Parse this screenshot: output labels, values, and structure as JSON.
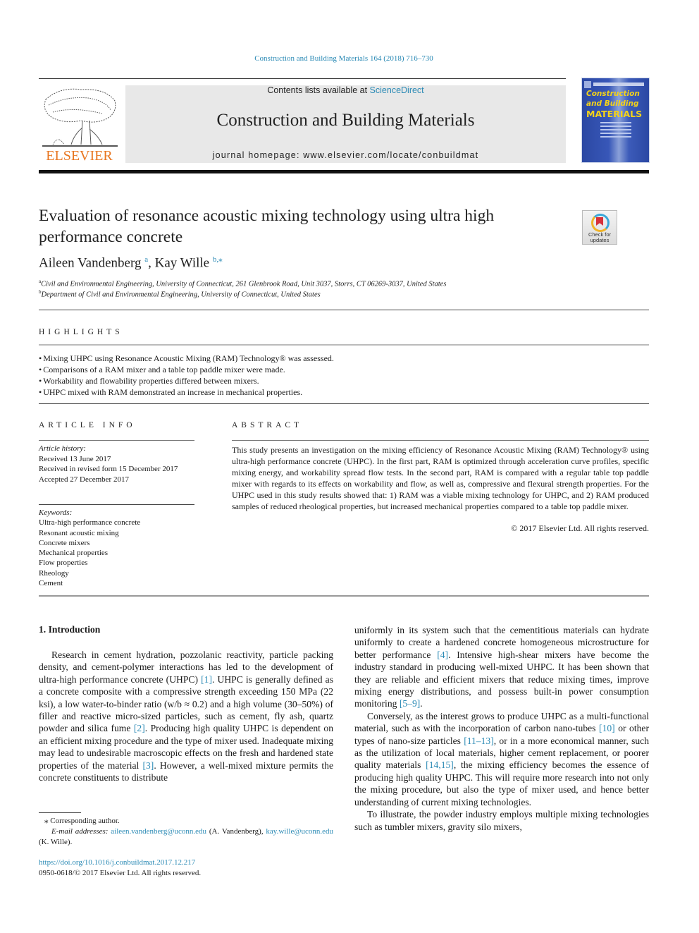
{
  "header": {
    "citation": "Construction and Building Materials 164 (2018) 716–730",
    "publisher_logo_text": "ELSEVIER",
    "contents_prefix": "Contents lists available at ",
    "contents_link": "ScienceDirect",
    "journal_title": "Construction and Building Materials",
    "homepage": "journal homepage: www.elsevier.com/locate/conbuildmat",
    "cover": {
      "line1": "Construction",
      "line2": "and Building",
      "line3": "MATERIALS",
      "bg_color": "#2b48a3",
      "title_color": "#f3d21a"
    },
    "crossmark_label": "Check for updates"
  },
  "article": {
    "title": "Evaluation of resonance acoustic mixing technology using ultra high performance concrete",
    "authors": [
      {
        "name": "Aileen Vandenberg",
        "mark": "a"
      },
      {
        "name": "Kay Wille",
        "mark": "b,⁎"
      }
    ],
    "affiliations": [
      {
        "mark": "a",
        "text": "Civil and Environmental Engineering, University of Connecticut, 261 Glenbrook Road, Unit 3037, Storrs, CT 06269-3037, United States"
      },
      {
        "mark": "b",
        "text": "Department of Civil and Environmental Engineering, University of Connecticut, United States"
      }
    ]
  },
  "highlights": {
    "heading": "HIGHLIGHTS",
    "items": [
      "Mixing UHPC using Resonance Acoustic Mixing (RAM) Technology® was assessed.",
      "Comparisons of a RAM mixer and a table top paddle mixer were made.",
      "Workability and flowability properties differed between mixers.",
      "UHPC mixed with RAM demonstrated an increase in mechanical properties."
    ]
  },
  "article_info": {
    "heading": "ARTICLE INFO",
    "history_label": "Article history:",
    "history": [
      "Received 13 June 2017",
      "Received in revised form 15 December 2017",
      "Accepted 27 December 2017"
    ],
    "keywords_label": "Keywords:",
    "keywords": [
      "Ultra-high performance concrete",
      "Resonant acoustic mixing",
      "Concrete mixers",
      "Mechanical properties",
      "Flow properties",
      "Rheology",
      "Cement"
    ]
  },
  "abstract": {
    "heading": "ABSTRACT",
    "text": "This study presents an investigation on the mixing efficiency of Resonance Acoustic Mixing (RAM) Technology® using ultra-high performance concrete (UHPC). In the first part, RAM is optimized through acceleration curve profiles, specific mixing energy, and workability spread flow tests. In the second part, RAM is compared with a regular table top paddle mixer with regards to its effects on workability and flow, as well as, compressive and flexural strength properties. For the UHPC used in this study results showed that: 1) RAM was a viable mixing technology for UHPC, and 2) RAM produced samples of reduced rheological properties, but increased mechanical properties compared to a table top paddle mixer.",
    "copyright": "© 2017 Elsevier Ltd. All rights reserved."
  },
  "introduction": {
    "heading": "1. Introduction",
    "col1": {
      "p1_a": "Research in cement hydration, pozzolanic reactivity, particle packing density, and cement-polymer interactions has led to the development of ultra-high performance concrete (UHPC) ",
      "ref1": "[1]",
      "p1_b": ". UHPC is generally defined as a concrete composite with a compressive strength exceeding 150 MPa (22 ksi), a low water-to-binder ratio (w/b ≈ 0.2) and a high volume (30–50%) of filler and reactive micro-sized particles, such as cement, fly ash, quartz powder and silica fume ",
      "ref2": "[2]",
      "p1_c": ". Producing high quality UHPC is dependent on an efficient mixing procedure and the type of mixer used. Inadequate mixing may lead to undesirable macroscopic effects on the fresh and hardened state properties of the material ",
      "ref3": "[3]",
      "p1_d": ". However, a well-mixed mixture permits the concrete constituents to distribute"
    },
    "col2": {
      "p0_a": "uniformly in its system such that the cementitious materials can hydrate uniformly to create a hardened concrete homogeneous microstructure for better performance ",
      "ref4": "[4]",
      "p0_b": ". Intensive high-shear mixers have become the industry standard in producing well-mixed UHPC. It has been shown that they are reliable and efficient mixers that reduce mixing times, improve mixing energy distributions, and possess built-in power consumption monitoring ",
      "ref5": "[5–9]",
      "p0_c": ".",
      "p1_a": "Conversely, as the interest grows to produce UHPC as a multi-functional material, such as with the incorporation of carbon nano-tubes ",
      "ref10": "[10]",
      "p1_b": " or other types of nano-size particles ",
      "ref11": "[11–13]",
      "p1_c": ", or in a more economical manner, such as the utilization of local materials, higher cement replacement, or poorer quality materials ",
      "ref14": "[14,15]",
      "p1_d": ", the mixing efficiency becomes the essence of producing high quality UHPC. This will require more research into not only the mixing procedure, but also the type of mixer used, and hence better understanding of current mixing technologies.",
      "p2": "To illustrate, the powder industry employs multiple mixing technologies such as tumbler mixers, gravity silo mixers,"
    }
  },
  "footnotes": {
    "corresponding": "⁎ Corresponding author.",
    "email_label": "E-mail addresses: ",
    "email1": "aileen.vandenberg@uconn.edu",
    "email1_owner": " (A. Vandenberg), ",
    "email2": "kay.wille@uconn.edu",
    "email2_owner": " (K. Wille).",
    "doi": "https://doi.org/10.1016/j.conbuildmat.2017.12.217",
    "issn": "0950-0618/© 2017 Elsevier Ltd. All rights reserved."
  }
}
